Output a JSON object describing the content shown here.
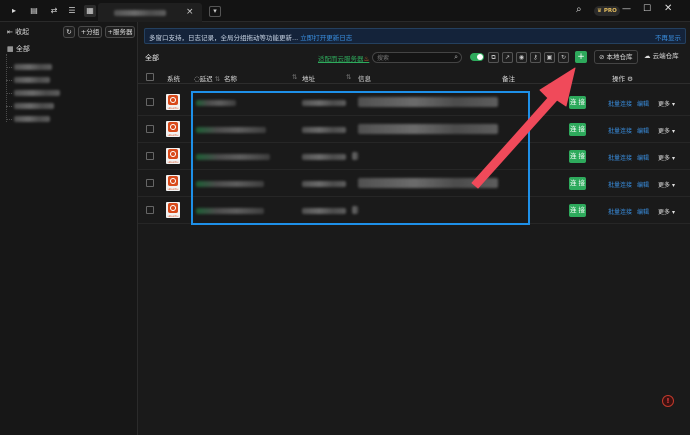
{
  "titlebar": {
    "icons": [
      "terminal-icon",
      "file-icon",
      "transfer-icon",
      "list-icon"
    ],
    "tab_close": "×",
    "tab_dropdown": "▾",
    "pro_badge": "PRO"
  },
  "sidebar": {
    "collapse_label": "收起",
    "refresh_icon": "↻",
    "add_group_label": "+分组",
    "add_server_label": "+服务器",
    "all_label": "全部"
  },
  "banner": {
    "text": "多窗口支持，日志记录，全局分组拖动等功能更新...",
    "link_text": "立即打开更新日志",
    "dismiss_text": "不再显示"
  },
  "toolbar": {
    "title": "全部",
    "cloud_hint": "适配而云服务器",
    "search_placeholder": "搜索",
    "local_repo_label": "本地仓库",
    "cloud_repo_label": "云端仓库",
    "add_label": "+"
  },
  "table": {
    "headers": {
      "os": "系统",
      "status": "延迟",
      "name": "名称",
      "address": "地址",
      "info": "信息",
      "note": "备注",
      "ops": "操作"
    },
    "rows": [
      {
        "os": "ubuntu",
        "connect": "连 接",
        "batch": "批量连接",
        "edit": "编辑",
        "more": "更多"
      },
      {
        "os": "ubuntu",
        "connect": "连 接",
        "batch": "批量连接",
        "edit": "编辑",
        "more": "更多"
      },
      {
        "os": "ubuntu",
        "connect": "连 接",
        "batch": "批量连接",
        "edit": "编辑",
        "more": "更多"
      },
      {
        "os": "ubuntu",
        "connect": "连 接",
        "batch": "批量连接",
        "edit": "编辑",
        "more": "更多"
      },
      {
        "os": "ubuntu",
        "connect": "连 接",
        "batch": "批量连接",
        "edit": "编辑",
        "more": "更多"
      }
    ]
  },
  "colors": {
    "accent_green": "#2eaa5c",
    "link_blue": "#3a8fe0",
    "highlight_blue": "#1e90e8",
    "arrow_red": "#f04a5a"
  }
}
